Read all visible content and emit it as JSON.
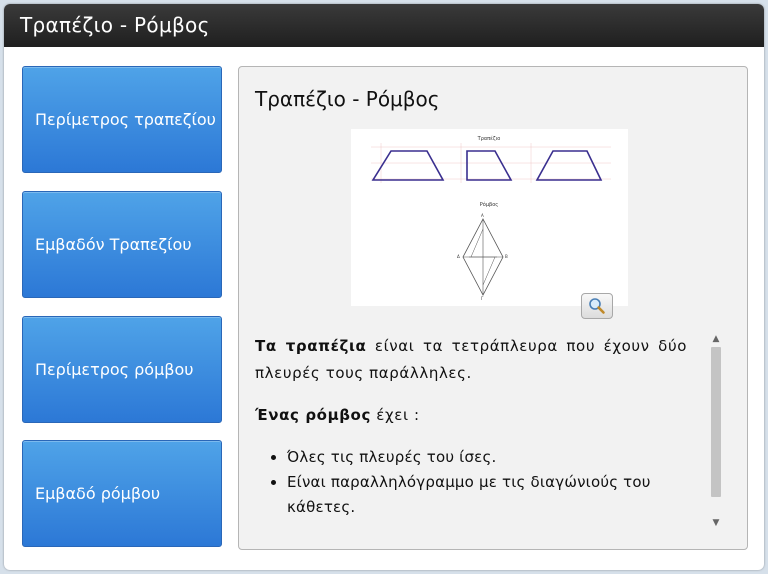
{
  "window": {
    "title": "Τραπέζιο - Ρόμβος"
  },
  "sidebar": {
    "items": [
      {
        "label": "Περίμετρος τραπεζίου"
      },
      {
        "label": "Εμβαδόν Τραπεζίου"
      },
      {
        "label": "Περίμετρος ρόμβου"
      },
      {
        "label": "Εμβαδό ρόμβου"
      }
    ]
  },
  "content": {
    "title": "Τραπέζιο - Ρόμβος",
    "figure": {
      "trapezoid_caption": "Τραπέζιο",
      "rhombus_caption": "Ρόμβος",
      "vertex_labels": [
        "Α",
        "Β",
        "Γ",
        "Δ"
      ]
    },
    "zoom_icon": "magnifier-icon",
    "paragraph1_bold": "Τα τραπέζια",
    "paragraph1_rest": " είναι τα τετράπλευρα που έχουν δύο πλευρές τους παράλληλες.",
    "paragraph2_bold": "Ένας ρόμβος",
    "paragraph2_rest": " έχει :",
    "bullets": [
      "Όλες τις πλευρές του ίσες.",
      "Είναι παραλληλόγραμμο με τις διαγώνιούς του κάθετες."
    ]
  },
  "colors": {
    "button_top": "#4fa3e8",
    "button_bottom": "#2c78d6",
    "titlebar": "#2a2a2a",
    "shape_stroke": "#3a2f8f"
  }
}
